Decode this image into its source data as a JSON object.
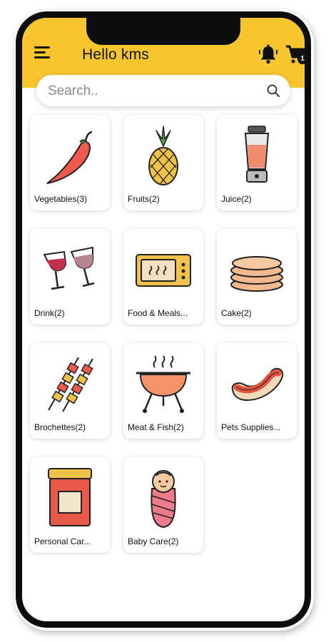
{
  "header": {
    "greeting": "Hello kms",
    "cart_count": "1",
    "accent_color": "#f7c62f"
  },
  "search": {
    "placeholder": "Search.."
  },
  "categories": [
    {
      "label": "Vegetables(3)",
      "icon": "chili-pepper-icon"
    },
    {
      "label": "Fruits(2)",
      "icon": "pineapple-icon"
    },
    {
      "label": "Juice(2)",
      "icon": "blender-icon"
    },
    {
      "label": "Drink(2)",
      "icon": "wine-glasses-icon"
    },
    {
      "label": "Food & Meals...",
      "icon": "microwave-icon"
    },
    {
      "label": "Cake(2)",
      "icon": "pancakes-icon"
    },
    {
      "label": "Brochettes(2)",
      "icon": "skewers-icon"
    },
    {
      "label": "Meat & Fish(2)",
      "icon": "barbecue-grill-icon"
    },
    {
      "label": "Pets Supplies...",
      "icon": "sausage-icon"
    },
    {
      "label": "Personal Car...",
      "icon": "jar-icon"
    },
    {
      "label": "Baby Care(2)",
      "icon": "swaddled-baby-icon"
    }
  ]
}
